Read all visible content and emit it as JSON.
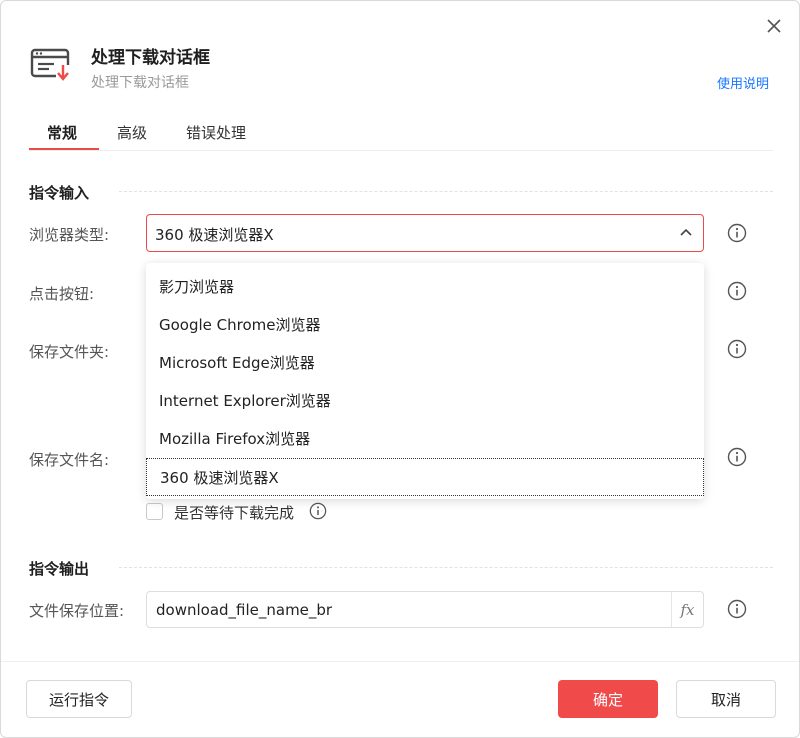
{
  "dialog": {
    "title": "处理下载对话框",
    "subtitle": "处理下载对话框",
    "help_link": "使用说明"
  },
  "tabs": [
    {
      "label": "常规",
      "active": true
    },
    {
      "label": "高级",
      "active": false
    },
    {
      "label": "错误处理",
      "active": false
    }
  ],
  "input_section": {
    "title": "指令输入",
    "browser_type_label": "浏览器类型:",
    "browser_type_value": "360 极速浏览器X",
    "click_button_label": "点击按钮:",
    "save_folder_label": "保存文件夹:",
    "save_filename_label": "保存文件名:",
    "wait_download_label": "是否等待下载完成",
    "wait_download_checked": false
  },
  "dropdown": {
    "options": [
      "影刀浏览器",
      "Google Chrome浏览器",
      "Microsoft Edge浏览器",
      "Internet Explorer浏览器",
      "Mozilla Firefox浏览器",
      "360 极速浏览器X"
    ],
    "selected_index": 5
  },
  "output_section": {
    "title": "指令输出",
    "file_location_label": "文件保存位置:",
    "file_location_value": "download_file_name_br",
    "fx_label": "fx"
  },
  "footer": {
    "run_label": "运行指令",
    "confirm_label": "确定",
    "cancel_label": "取消"
  },
  "colors": {
    "accent": "#f04a4a",
    "link": "#1677ff"
  }
}
